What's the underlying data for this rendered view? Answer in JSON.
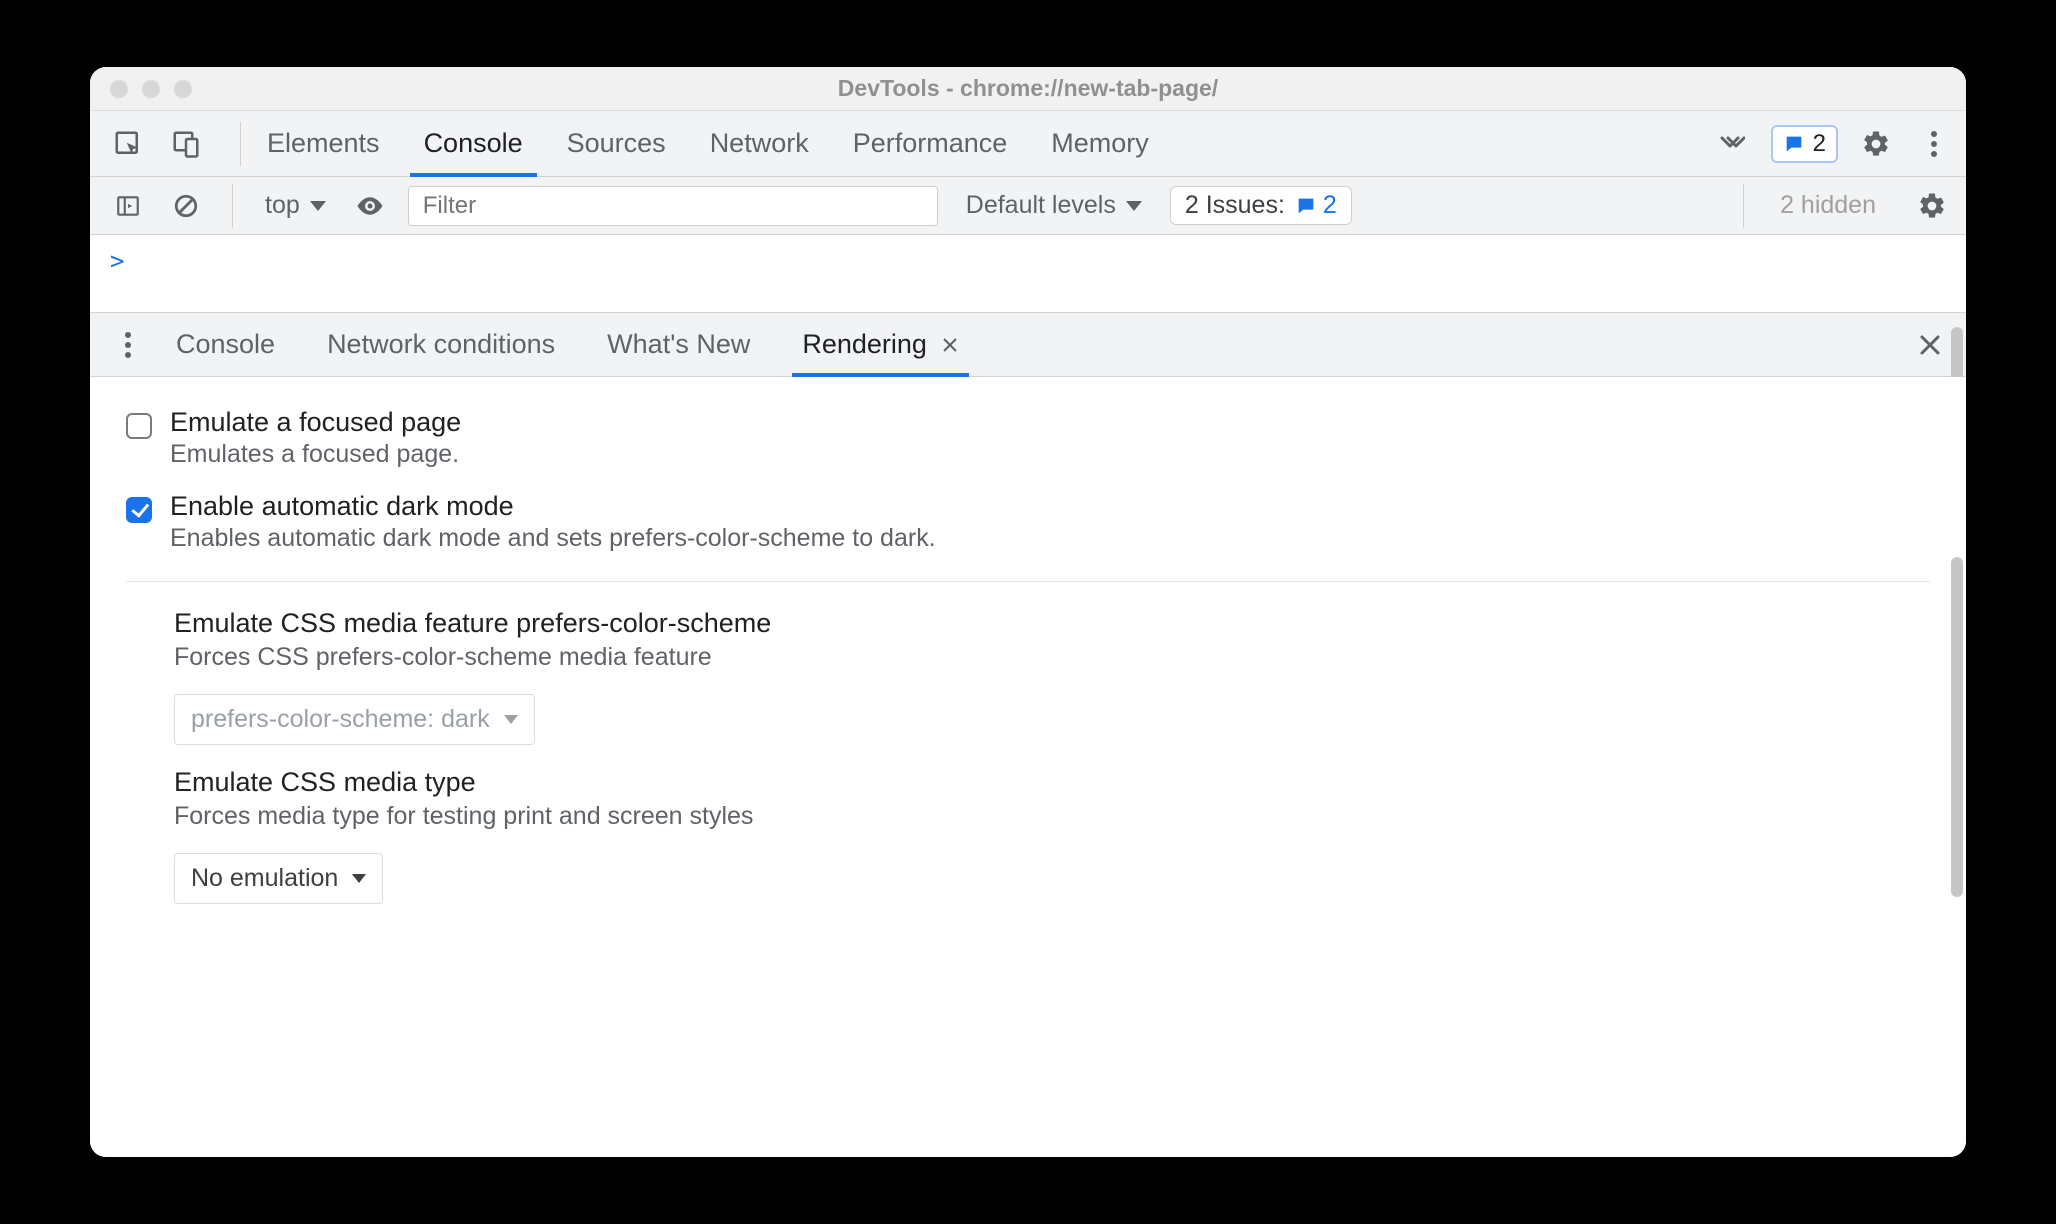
{
  "window": {
    "title": "DevTools - chrome://new-tab-page/"
  },
  "toolbar": {
    "tabs": [
      "Elements",
      "Console",
      "Sources",
      "Network",
      "Performance",
      "Memory"
    ],
    "active_tab_index": 1,
    "errors_count": "2"
  },
  "console_bar": {
    "context_label": "top",
    "filter_placeholder": "Filter",
    "levels_label": "Default levels",
    "issues_label_prefix": "2 Issues:",
    "issues_count": "2",
    "hidden_label": "2 hidden"
  },
  "prompt": ">",
  "drawer": {
    "tabs": [
      "Console",
      "Network conditions",
      "What's New",
      "Rendering"
    ],
    "active_tab_index": 3
  },
  "rendering": {
    "focused_page": {
      "title": "Emulate a focused page",
      "desc": "Emulates a focused page.",
      "checked": false
    },
    "auto_dark": {
      "title": "Enable automatic dark mode",
      "desc": "Enables automatic dark mode and sets prefers-color-scheme to dark.",
      "checked": true
    },
    "pcs": {
      "title": "Emulate CSS media feature prefers-color-scheme",
      "desc": "Forces CSS prefers-color-scheme media feature",
      "select_value": "prefers-color-scheme: dark",
      "select_disabled": true
    },
    "media_type": {
      "title": "Emulate CSS media type",
      "desc": "Forces media type for testing print and screen styles",
      "select_value": "No emulation",
      "select_disabled": false
    }
  }
}
